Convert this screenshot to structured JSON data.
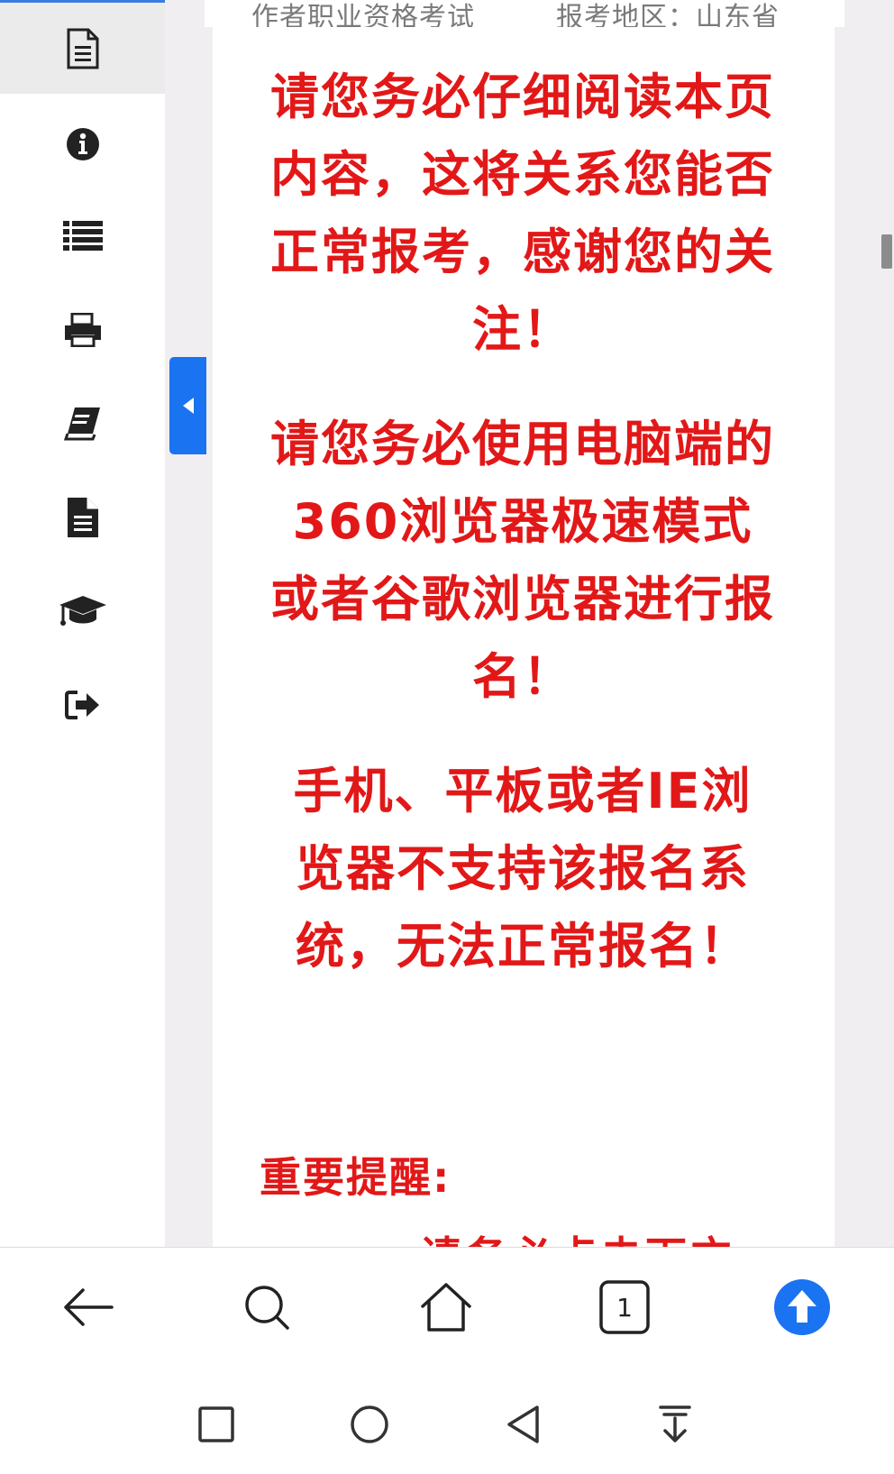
{
  "header": {
    "exam_text": "作者职业资格考试",
    "region_text": "报考地区：山东省"
  },
  "notices": [
    "请您务必仔细阅读本页内容，这将关系您能否正常报考，感谢您的关注！",
    "请您务必使用电脑端的360浏览器极速模式或者谷歌浏览器进行报名！",
    "手机、平板或者IE浏览器不支持该报名系统，无法正常报名！"
  ],
  "reminder": {
    "title": "重要提醒:",
    "cut_line": "请务必点击下方"
  },
  "sidebar": {
    "items": [
      {
        "icon": "document-icon"
      },
      {
        "icon": "info-icon"
      },
      {
        "icon": "list-icon"
      },
      {
        "icon": "printer-icon"
      },
      {
        "icon": "book-icon"
      },
      {
        "icon": "file-icon"
      },
      {
        "icon": "graduation-cap-icon"
      },
      {
        "icon": "logout-icon"
      }
    ]
  },
  "browser_bar": {
    "tab_count": "1",
    "icons": [
      "back-arrow-icon",
      "search-icon",
      "home-icon",
      "tabs-icon",
      "upload-icon"
    ]
  },
  "system_nav": {
    "icons": [
      "recent-apps-icon",
      "home-circle-icon",
      "back-triangle-icon",
      "download-icon"
    ]
  },
  "colors": {
    "notice_red": "#e21818",
    "accent_blue": "#1a73f0",
    "page_bg": "#f1eef2"
  }
}
